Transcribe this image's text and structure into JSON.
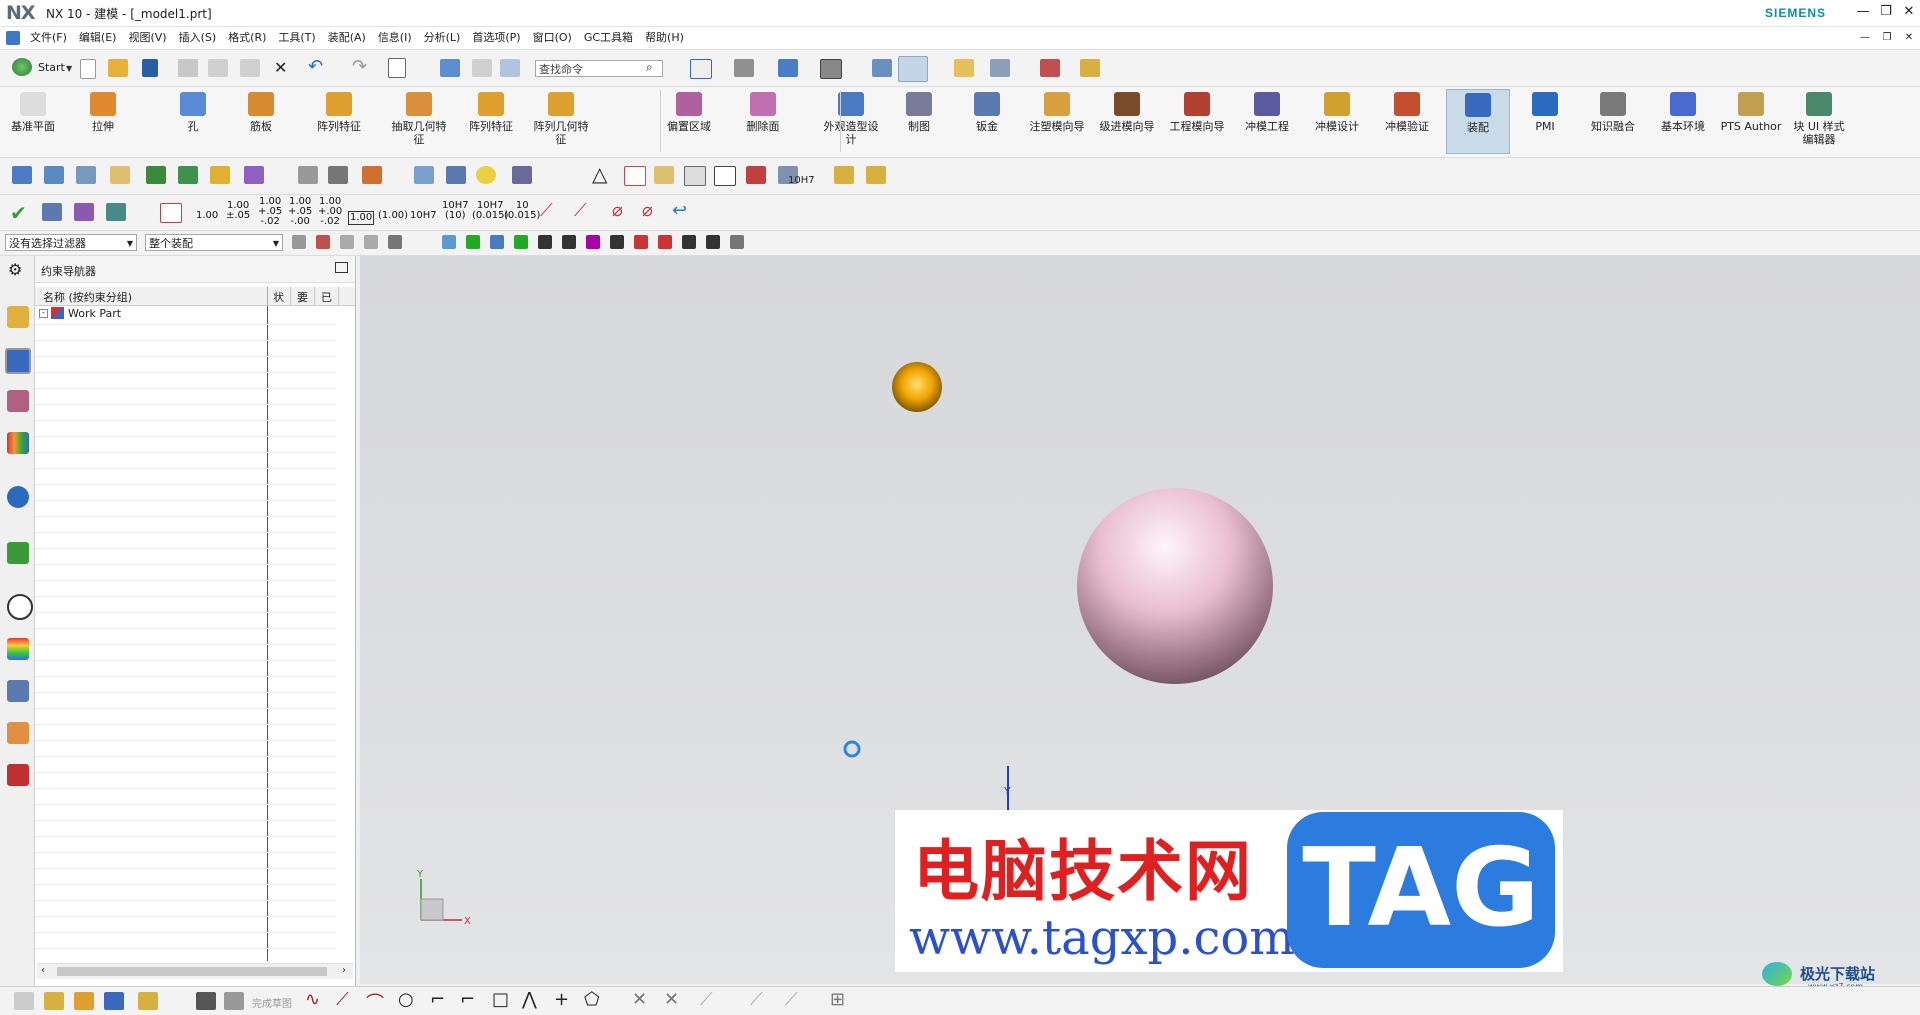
{
  "title_bar": {
    "logo": "NX",
    "title": "NX 10 - 建模 - [_model1.prt]",
    "brand": "SIEMENS"
  },
  "menu": [
    "文件(F)",
    "编辑(E)",
    "视图(V)",
    "插入(S)",
    "格式(R)",
    "工具(T)",
    "装配(A)",
    "信息(I)",
    "分析(L)",
    "首选项(P)",
    "窗口(O)",
    "GC工具箱",
    "帮助(H)"
  ],
  "quick_toolbar": {
    "start_label": "Start",
    "command_search_placeholder": "查找命令"
  },
  "ribbon": {
    "feature_group": [
      "基准平面",
      "拉伸",
      "孔",
      "筋板",
      "阵列特征",
      "抽取几何特征",
      "阵列特征",
      "阵列几何特征"
    ],
    "sync_group": [
      "偏置区域",
      "删除面"
    ],
    "app_group": [
      "外观造型设计",
      "制图",
      "钣金",
      "注塑模向导",
      "级进模向导",
      "工程模向导",
      "冲模工程",
      "冲模设计",
      "冲模验证",
      "装配",
      "PMI",
      "知识融合",
      "基本环境",
      "PTS Author",
      "块 UI 样式编辑器"
    ],
    "active": "装配"
  },
  "tolerance_toolbar": {
    "values": [
      "1.00",
      "1.00\n±.05",
      "1.00\n+.05\n-.02",
      "1.00\n+.05\n-.00",
      "1.00\n+.00\n-.02",
      "1.00",
      "(1.00)",
      "10H7",
      "10H7\n(10)",
      "10H7\n(0.015)",
      "10\n(0.015)"
    ],
    "fit_label": "10H7"
  },
  "selection_bar": {
    "filter": "没有选择过滤器",
    "scope": "整个装配"
  },
  "navigator": {
    "title": "约束导航器",
    "columns": [
      "名称 (按约束分组)",
      "状",
      "要",
      "已"
    ],
    "tree": [
      {
        "label": "Work Part",
        "expanded": true
      }
    ]
  },
  "viewport": {
    "axis_labels": {
      "x": "X",
      "y": "Y"
    },
    "sphere_color": "#e8bfcf",
    "cone_color": "#f0a400"
  },
  "watermark": {
    "cn_text": "电脑技术网",
    "url": "www.tagxp.com",
    "tag": "TAG",
    "corner": "极光下载站",
    "corner_url": "www.xz7.com"
  },
  "bottom_toolbar": {
    "finish_sketch": "完成草图"
  }
}
